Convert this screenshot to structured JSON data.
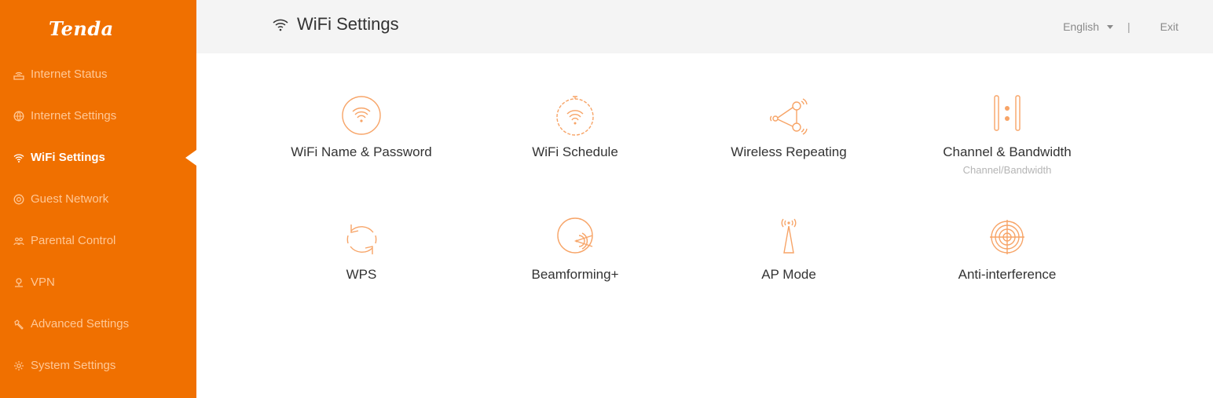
{
  "brand": {
    "logo_text": "Tenda",
    "accent": "#f07000"
  },
  "sidebar": {
    "items": [
      {
        "label": "Internet Status",
        "icon": "router-icon",
        "active": false
      },
      {
        "label": "Internet Settings",
        "icon": "globe-icon",
        "active": false
      },
      {
        "label": "WiFi Settings",
        "icon": "wifi-icon",
        "active": true
      },
      {
        "label": "Guest Network",
        "icon": "guest-network-icon",
        "active": false
      },
      {
        "label": "Parental Control",
        "icon": "parental-control-icon",
        "active": false
      },
      {
        "label": "VPN",
        "icon": "vpn-icon",
        "active": false
      },
      {
        "label": "Advanced Settings",
        "icon": "wrench-icon",
        "active": false
      },
      {
        "label": "System Settings",
        "icon": "gear-icon",
        "active": false
      }
    ]
  },
  "header": {
    "title": "WiFi Settings",
    "title_icon": "wifi-icon",
    "language": "English",
    "separator": "|",
    "exit_label": "Exit"
  },
  "tiles": [
    {
      "label": "WiFi Name & Password",
      "icon": "wifi-circle-icon"
    },
    {
      "label": "WiFi Schedule",
      "icon": "wifi-timer-icon"
    },
    {
      "label": "Wireless Repeating",
      "icon": "repeater-icon"
    },
    {
      "label": "Channel & Bandwidth",
      "sub": "Channel/Bandwidth",
      "icon": "channel-bandwidth-icon"
    },
    {
      "label": "WPS",
      "icon": "wps-sync-icon"
    },
    {
      "label": "Beamforming+",
      "icon": "beamforming-icon"
    },
    {
      "label": "AP Mode",
      "icon": "ap-antenna-icon"
    },
    {
      "label": "Anti-interference",
      "icon": "anti-interference-icon"
    }
  ]
}
